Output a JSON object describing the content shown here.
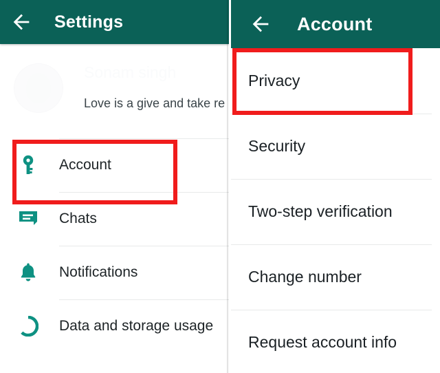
{
  "meta": {
    "accent_teal": "#0b6157",
    "highlight_red": "#f01c1c",
    "text_primary": "#1d2326",
    "divider": "#e8eaea"
  },
  "left_panel": {
    "appbar": {
      "back_icon": "back-arrow-icon",
      "title": "Settings"
    },
    "profile": {
      "avatar_icon": "profile-avatar-ghost",
      "name": "Sonam singh",
      "status": "Love is a give and take re"
    },
    "items": [
      {
        "label": "Account",
        "icon": "key-icon",
        "highlighted": true
      },
      {
        "label": "Chats",
        "icon": "chat-bubble-icon",
        "highlighted": false
      },
      {
        "label": "Notifications",
        "icon": "bell-icon",
        "highlighted": false
      },
      {
        "label": "Data and storage usage",
        "icon": "data-usage-icon",
        "highlighted": false
      }
    ]
  },
  "right_panel": {
    "appbar": {
      "back_icon": "back-arrow-icon",
      "title": "Account"
    },
    "items": [
      {
        "label": "Privacy",
        "highlighted": true
      },
      {
        "label": "Security",
        "highlighted": false
      },
      {
        "label": "Two-step verification",
        "highlighted": false
      },
      {
        "label": "Change number",
        "highlighted": false
      },
      {
        "label": "Request account info",
        "highlighted": false
      }
    ]
  }
}
